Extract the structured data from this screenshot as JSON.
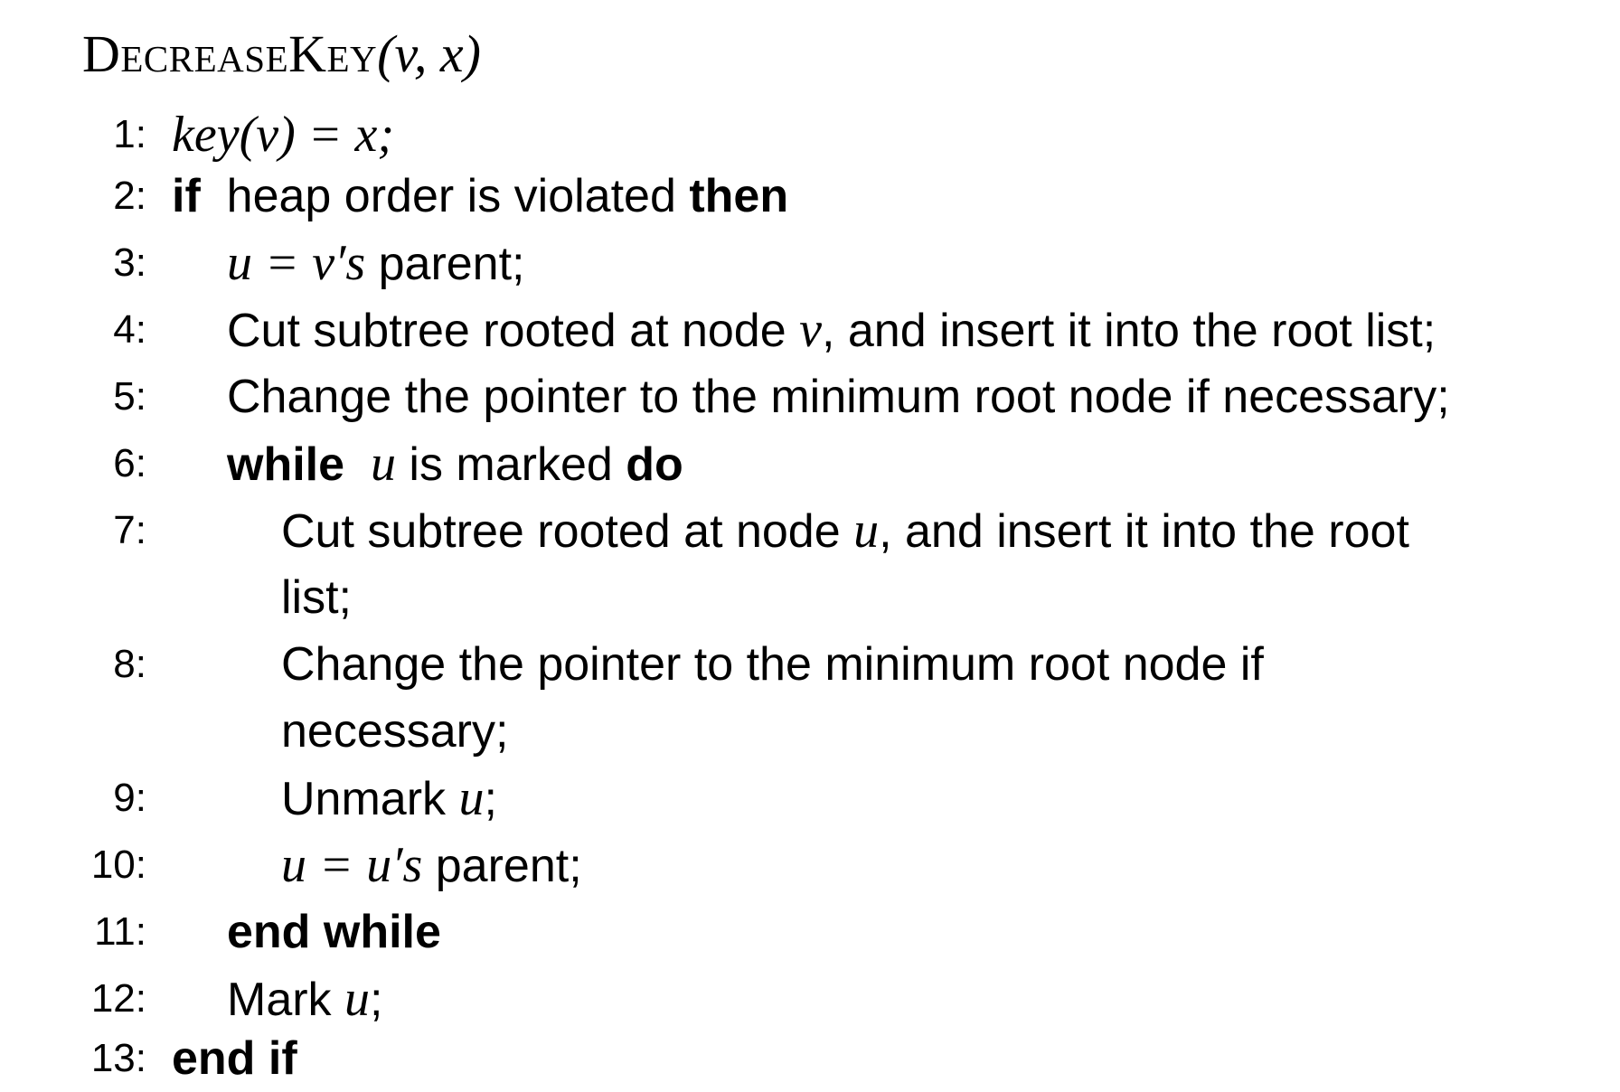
{
  "title": {
    "name": "DecreaseKey",
    "args": "(v, x)"
  },
  "lines": [
    {
      "num": "1:",
      "expr": "key(v) = x;"
    },
    {
      "num": "2:",
      "kw_if": "if",
      "text": "heap order is violated",
      "kw_then": "then"
    },
    {
      "num": "3:",
      "math_u": "u =",
      "math_vs": "v′s",
      "text": "parent;"
    },
    {
      "num": "4:",
      "text_a": "Cut subtree rooted at node",
      "math": "v",
      "text_b": ", and insert it into the root list;"
    },
    {
      "num": "5:",
      "text": "Change the pointer to the minimum root node if necessary;"
    },
    {
      "num": "6:",
      "kw_while": "while",
      "math": "u",
      "text": "is marked",
      "kw_do": "do"
    },
    {
      "num": "7:",
      "text_a": "Cut subtree rooted at node",
      "math": "u",
      "text_b": ", and insert it into the root",
      "text_c": "list;"
    },
    {
      "num": "8:",
      "text_a": "Change the pointer to the minimum root node if",
      "text_b": "necessary;"
    },
    {
      "num": "9:",
      "text": "Unmark",
      "math": "u",
      "punct": ";"
    },
    {
      "num": "10:",
      "math_u": "u =",
      "math_us": "u′s",
      "text": "parent;"
    },
    {
      "num": "11:",
      "kw": "end while"
    },
    {
      "num": "12:",
      "text": "Mark",
      "math": "u",
      "punct": ";"
    },
    {
      "num": "13:",
      "kw": "end if"
    }
  ]
}
